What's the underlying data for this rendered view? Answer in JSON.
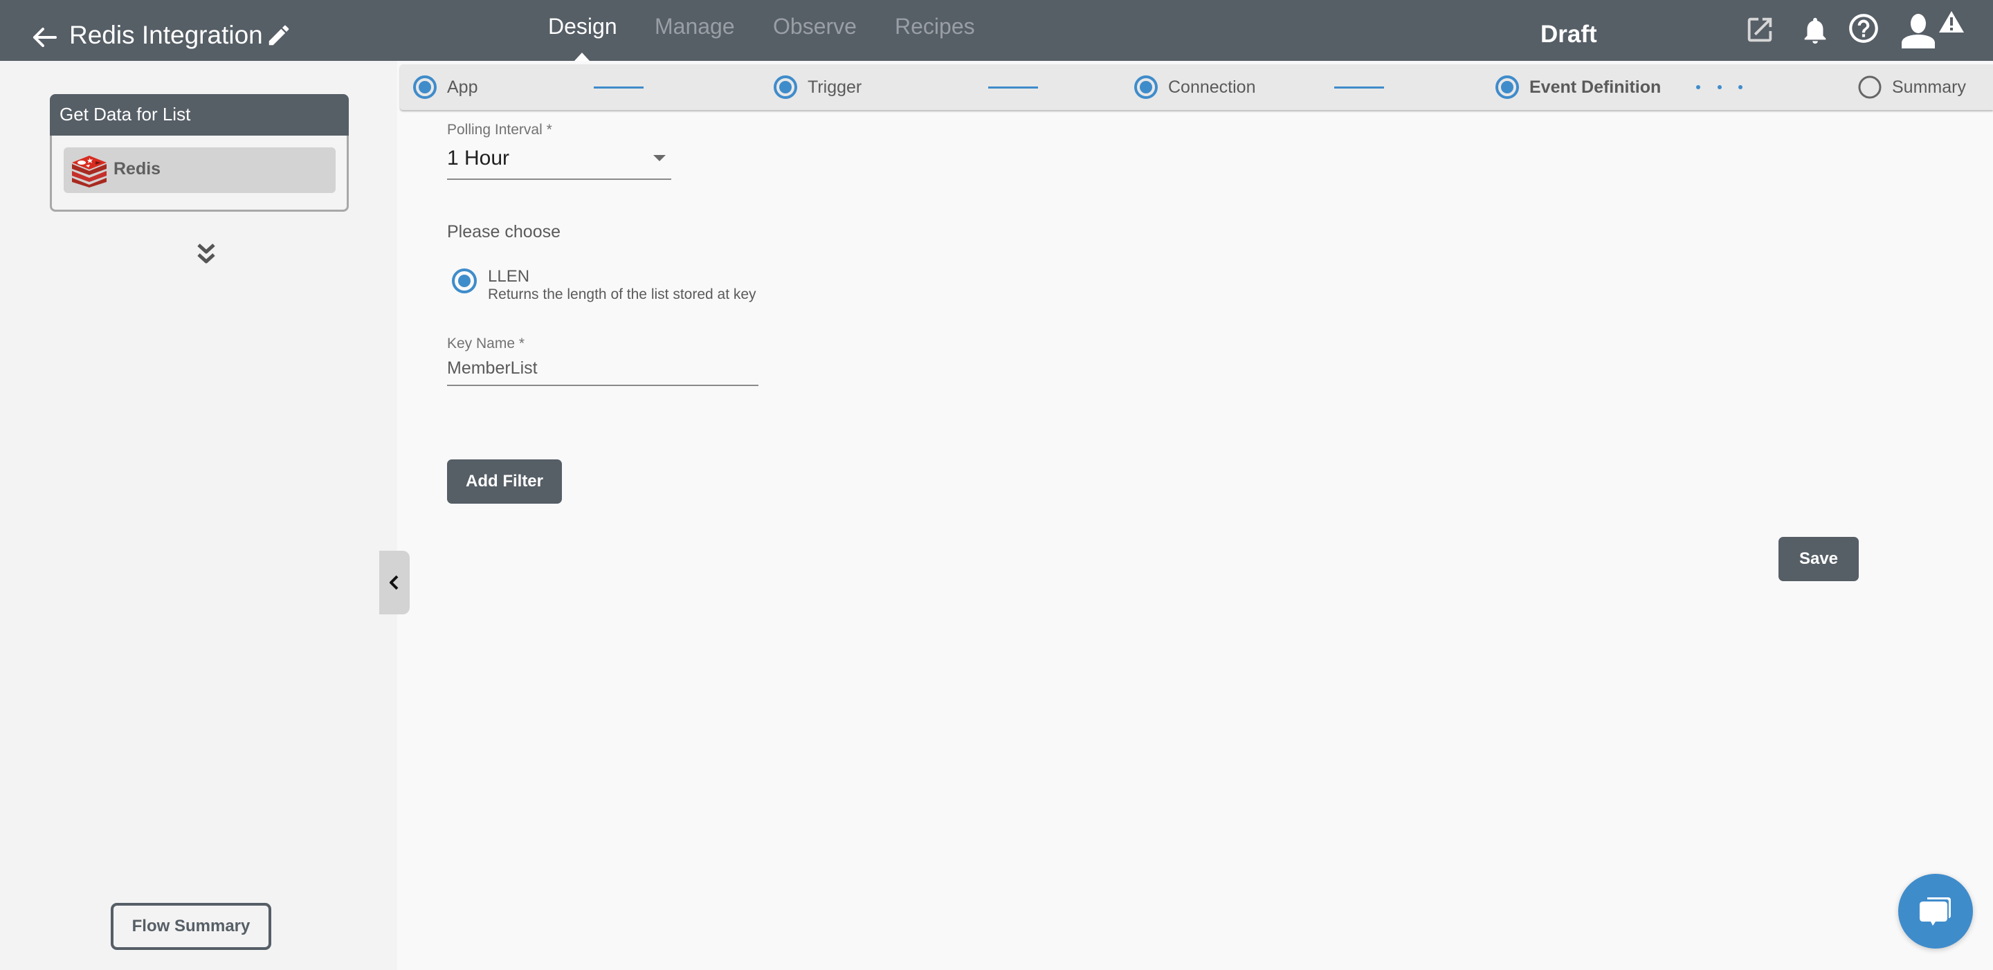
{
  "header": {
    "back_icon": "arrow-left-icon",
    "title": "Redis Integration",
    "edit_icon": "pencil-icon",
    "tabs": [
      {
        "label": "Design",
        "active": true
      },
      {
        "label": "Manage",
        "active": false
      },
      {
        "label": "Observe",
        "active": false
      },
      {
        "label": "Recipes",
        "active": false
      }
    ],
    "status": "Draft",
    "icons": [
      "external-link-icon",
      "bell-icon",
      "help-icon",
      "user-icon",
      "warning-icon"
    ]
  },
  "sidebar": {
    "flow_card": {
      "title": "Get Data for List",
      "connector": {
        "label": "Redis",
        "icon": "redis-logo-icon"
      }
    },
    "expand_icon": "double-chevron-down-icon",
    "flow_summary_label": "Flow Summary"
  },
  "stepper": {
    "steps": [
      {
        "label": "App",
        "state": "complete"
      },
      {
        "label": "Trigger",
        "state": "complete"
      },
      {
        "label": "Connection",
        "state": "complete"
      },
      {
        "label": "Event Definition",
        "state": "current"
      },
      {
        "label": "Summary",
        "state": "pending"
      }
    ],
    "accent": "#3f8ccb"
  },
  "form": {
    "polling_interval": {
      "label": "Polling Interval *",
      "value": "1 Hour"
    },
    "choose_heading": "Please choose",
    "options": [
      {
        "label": "LLEN",
        "description": "Returns the length of the list stored at key",
        "selected": true
      }
    ],
    "key_name": {
      "label": "Key Name *",
      "value": "MemberList"
    },
    "add_filter_label": "Add Filter",
    "save_label": "Save"
  },
  "colors": {
    "header_bg": "#565e66",
    "accent": "#3f8ccb",
    "button_bg": "#565e66"
  },
  "chat": {
    "icon": "chat-bubbles-icon"
  }
}
